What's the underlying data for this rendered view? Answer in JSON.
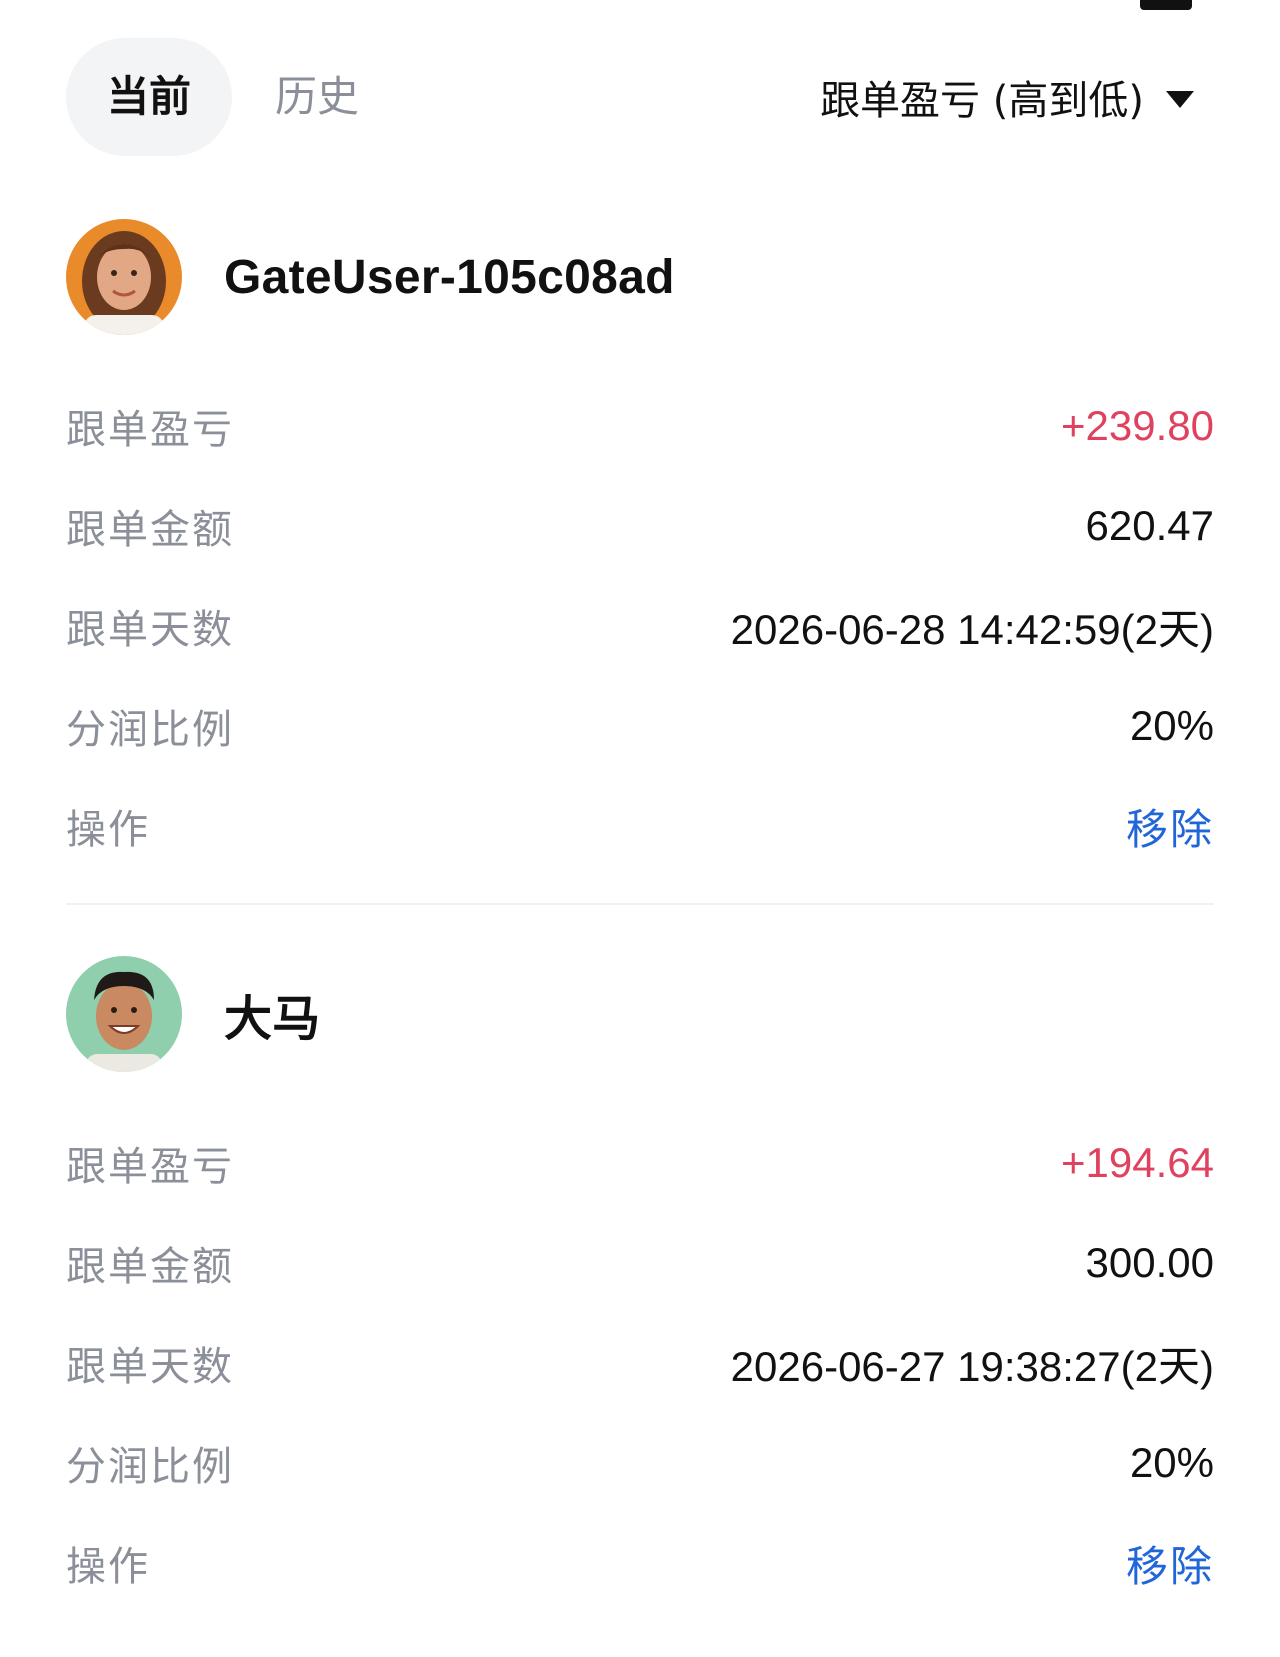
{
  "tabs": {
    "current": "当前",
    "history": "历史"
  },
  "sort": {
    "label": "跟单盈亏 (高到低)"
  },
  "row_labels": {
    "pnl": "跟单盈亏",
    "amount": "跟单金额",
    "days": "跟单天数",
    "share": "分润比例",
    "action": "操作"
  },
  "followers": [
    {
      "name": "GateUser-105c08ad",
      "pnl": "+239.80",
      "amount": "620.47",
      "days": "2026-06-28 14:42:59(2天)",
      "share": "20%",
      "action": "移除",
      "avatar_bg": "#e98b2a"
    },
    {
      "name": "大马",
      "pnl": "+194.64",
      "amount": "300.00",
      "days": "2026-06-27 19:38:27(2天)",
      "share": "20%",
      "action": "移除",
      "avatar_bg": "#8fcfae"
    }
  ],
  "colors": {
    "profit": "#e0415f",
    "link": "#2166d8",
    "label": "#8a8f99",
    "tab_active_bg": "#f3f4f6"
  },
  "icons": {
    "sort": "caret-down-icon"
  }
}
